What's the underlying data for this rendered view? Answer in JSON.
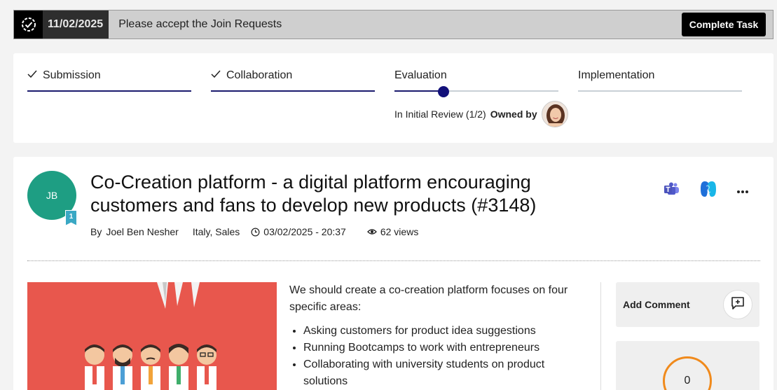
{
  "task": {
    "date": "11/02/2025",
    "message": "Please accept the Join Requests",
    "button_label": "Complete Task"
  },
  "stages": [
    {
      "label": "Submission",
      "status": "done"
    },
    {
      "label": "Collaboration",
      "status": "done"
    },
    {
      "label": "Evaluation",
      "status": "current",
      "progress": 0.3
    },
    {
      "label": "Implementation",
      "status": "pending"
    }
  ],
  "evaluation": {
    "sub_status": "In Initial Review (1/2)",
    "owned_by_label": "Owned by"
  },
  "idea": {
    "author_initials": "JB",
    "badge_count": "1",
    "title": "Co-Creation platform - a digital platform encouraging customers and fans to develop new products (#3148)",
    "by_label": "By",
    "author": "Joel Ben Nesher",
    "location": "Italy, Sales",
    "datetime": "03/02/2025 - 20:37",
    "views": "62 views",
    "description_intro": "We should create a co-creation platform focuses on four specific areas:",
    "bullets": [
      "Asking customers for product idea suggestions",
      "Running Bootcamps to work with entrepreneurs",
      "Collaborating with university students on product solutions"
    ]
  },
  "comments": {
    "add_label": "Add Comment"
  },
  "score": {
    "value": "0"
  },
  "colors": {
    "accent": "#12107a",
    "avatar_bg": "#1e9e83",
    "score_ring": "#f08a1c",
    "hero_bg": "#e8574d"
  }
}
